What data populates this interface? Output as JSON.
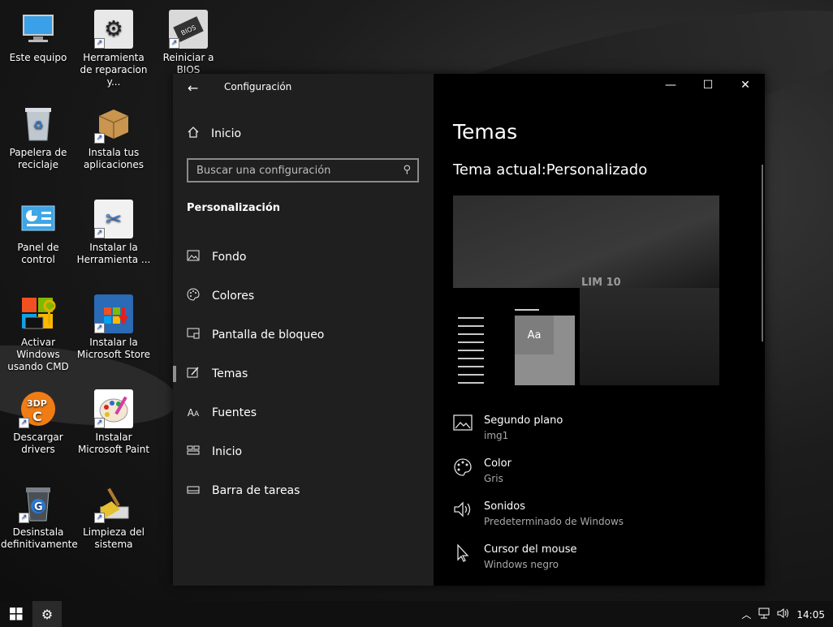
{
  "desktop": {
    "icons": [
      {
        "label": "Este equipo",
        "icon": "computer-icon"
      },
      {
        "label": "Herramienta de reparacion   y...",
        "icon": "repair-tool-icon"
      },
      {
        "label": "Reiniciar a BIOS",
        "icon": "bios-chip-icon"
      },
      {
        "label": "Papelera de reciclaje",
        "icon": "recycle-bin-icon"
      },
      {
        "label": "Instala tus aplicaciones",
        "icon": "package-box-icon"
      },
      {
        "label": "Panel de control",
        "icon": "control-panel-icon"
      },
      {
        "label": "Instalar la Herramienta ...",
        "icon": "install-tool-icon"
      },
      {
        "label": "Activar Windows usando CMD",
        "icon": "windows-key-icon"
      },
      {
        "label": "Instalar la Microsoft Store",
        "icon": "store-icon"
      },
      {
        "label": "Descargar drivers",
        "icon": "driver-download-icon"
      },
      {
        "label": "Instalar Microsoft Paint",
        "icon": "paint-palette-icon"
      },
      {
        "label": "Desinstala definitivamente",
        "icon": "uninstall-bin-icon"
      },
      {
        "label": "Limpieza del sistema",
        "icon": "broom-icon"
      }
    ]
  },
  "window": {
    "title": "Configuración",
    "home_label": "Inicio",
    "search_placeholder": "Buscar una configuración",
    "section": "Personalización",
    "nav": [
      {
        "label": "Fondo",
        "icon": "picture-icon"
      },
      {
        "label": "Colores",
        "icon": "palette-icon"
      },
      {
        "label": "Pantalla de bloqueo",
        "icon": "lock-screen-icon"
      },
      {
        "label": "Temas",
        "icon": "themes-icon",
        "active": true
      },
      {
        "label": "Fuentes",
        "icon": "fonts-icon"
      },
      {
        "label": "Inicio",
        "icon": "start-layout-icon"
      },
      {
        "label": "Barra de tareas",
        "icon": "taskbar-icon"
      }
    ],
    "heading": "Temas",
    "current_theme_label": "Tema actual:",
    "current_theme_value": "Personalizado",
    "preview_aa": "Aa",
    "preview_logo": "LIM 10",
    "properties": [
      {
        "title": "Segundo plano",
        "value": "img1",
        "icon": "picture-icon"
      },
      {
        "title": "Color",
        "value": "Gris",
        "icon": "palette-icon"
      },
      {
        "title": "Sonidos",
        "value": "Predeterminado de Windows",
        "icon": "speaker-icon"
      },
      {
        "title": "Cursor del mouse",
        "value": "Windows negro",
        "icon": "cursor-icon"
      }
    ]
  },
  "taskbar": {
    "clock": "14:05"
  }
}
